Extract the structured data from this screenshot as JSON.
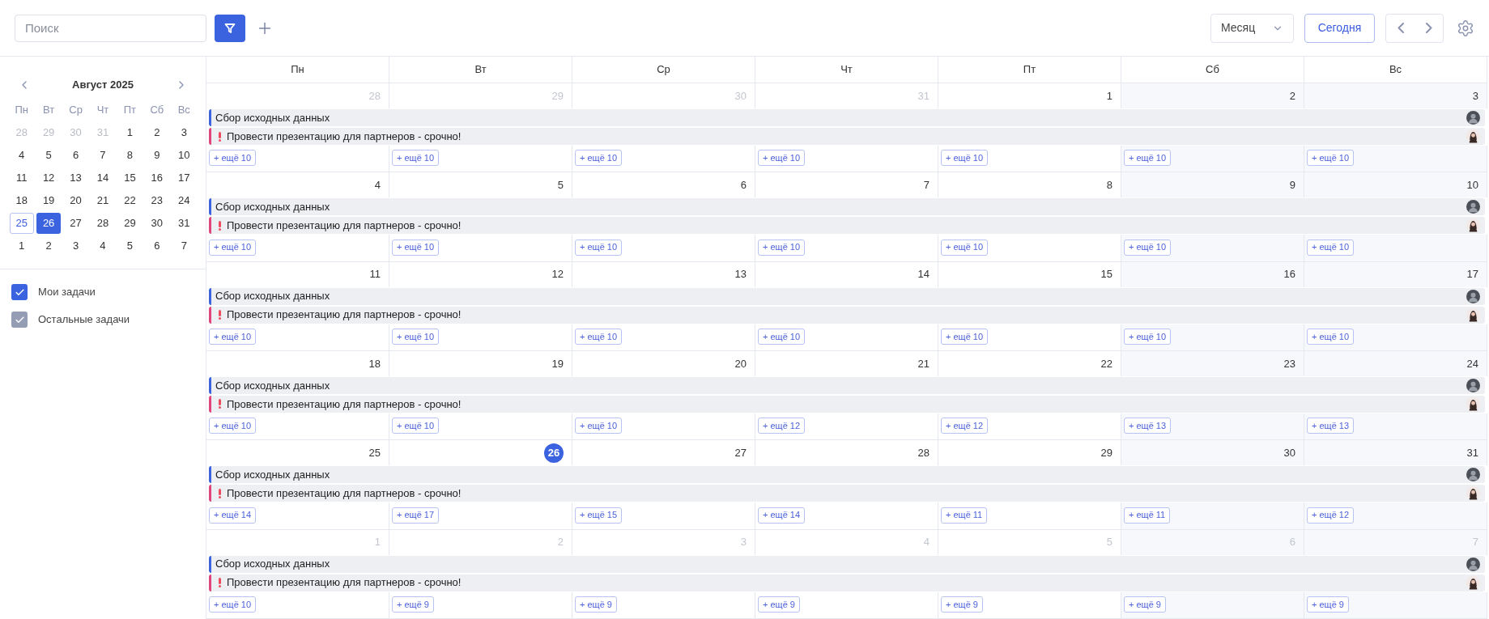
{
  "toolbar": {
    "search": {
      "placeholder": "Поиск"
    },
    "view_select": {
      "value": "Месяц"
    },
    "today_button": "Сегодня"
  },
  "mini_calendar": {
    "title": "Август 2025",
    "weekdays": [
      "Пн",
      "Вт",
      "Ср",
      "Чт",
      "Пт",
      "Сб",
      "Вс"
    ],
    "weeks": [
      [
        {
          "date": "28",
          "muted": true,
          "selected": false,
          "outlined": false
        },
        {
          "date": "29",
          "muted": true,
          "selected": false,
          "outlined": false
        },
        {
          "date": "30",
          "muted": true,
          "selected": false,
          "outlined": false
        },
        {
          "date": "31",
          "muted": true,
          "selected": false,
          "outlined": false
        },
        {
          "date": "1",
          "muted": false,
          "selected": false,
          "outlined": false
        },
        {
          "date": "2",
          "muted": false,
          "selected": false,
          "outlined": false
        },
        {
          "date": "3",
          "muted": false,
          "selected": false,
          "outlined": false
        }
      ],
      [
        {
          "date": "4",
          "muted": false,
          "selected": false,
          "outlined": false
        },
        {
          "date": "5",
          "muted": false,
          "selected": false,
          "outlined": false
        },
        {
          "date": "6",
          "muted": false,
          "selected": false,
          "outlined": false
        },
        {
          "date": "7",
          "muted": false,
          "selected": false,
          "outlined": false
        },
        {
          "date": "8",
          "muted": false,
          "selected": false,
          "outlined": false
        },
        {
          "date": "9",
          "muted": false,
          "selected": false,
          "outlined": false
        },
        {
          "date": "10",
          "muted": false,
          "selected": false,
          "outlined": false
        }
      ],
      [
        {
          "date": "11",
          "muted": false,
          "selected": false,
          "outlined": false
        },
        {
          "date": "12",
          "muted": false,
          "selected": false,
          "outlined": false
        },
        {
          "date": "13",
          "muted": false,
          "selected": false,
          "outlined": false
        },
        {
          "date": "14",
          "muted": false,
          "selected": false,
          "outlined": false
        },
        {
          "date": "15",
          "muted": false,
          "selected": false,
          "outlined": false
        },
        {
          "date": "16",
          "muted": false,
          "selected": false,
          "outlined": false
        },
        {
          "date": "17",
          "muted": false,
          "selected": false,
          "outlined": false
        }
      ],
      [
        {
          "date": "18",
          "muted": false,
          "selected": false,
          "outlined": false
        },
        {
          "date": "19",
          "muted": false,
          "selected": false,
          "outlined": false
        },
        {
          "date": "20",
          "muted": false,
          "selected": false,
          "outlined": false
        },
        {
          "date": "21",
          "muted": false,
          "selected": false,
          "outlined": false
        },
        {
          "date": "22",
          "muted": false,
          "selected": false,
          "outlined": false
        },
        {
          "date": "23",
          "muted": false,
          "selected": false,
          "outlined": false
        },
        {
          "date": "24",
          "muted": false,
          "selected": false,
          "outlined": false
        }
      ],
      [
        {
          "date": "25",
          "muted": false,
          "selected": false,
          "outlined": true
        },
        {
          "date": "26",
          "muted": false,
          "selected": true,
          "outlined": false
        },
        {
          "date": "27",
          "muted": false,
          "selected": false,
          "outlined": false
        },
        {
          "date": "28",
          "muted": false,
          "selected": false,
          "outlined": false
        },
        {
          "date": "29",
          "muted": false,
          "selected": false,
          "outlined": false
        },
        {
          "date": "30",
          "muted": false,
          "selected": false,
          "outlined": false
        },
        {
          "date": "31",
          "muted": false,
          "selected": false,
          "outlined": false
        }
      ],
      [
        {
          "date": "1",
          "muted": false,
          "selected": false,
          "outlined": false
        },
        {
          "date": "2",
          "muted": false,
          "selected": false,
          "outlined": false
        },
        {
          "date": "3",
          "muted": false,
          "selected": false,
          "outlined": false
        },
        {
          "date": "4",
          "muted": false,
          "selected": false,
          "outlined": false
        },
        {
          "date": "5",
          "muted": false,
          "selected": false,
          "outlined": false
        },
        {
          "date": "6",
          "muted": false,
          "selected": false,
          "outlined": false
        },
        {
          "date": "7",
          "muted": false,
          "selected": false,
          "outlined": false
        }
      ]
    ]
  },
  "filters": [
    {
      "label": "Мои задачи",
      "checked": true,
      "color": "#3b63e0"
    },
    {
      "label": "Остальные задачи",
      "checked": true,
      "color": "#959db5"
    }
  ],
  "calendar": {
    "weekdays": [
      "Пн",
      "Вт",
      "Ср",
      "Чт",
      "Пт",
      "Сб",
      "Вс"
    ],
    "weeks": [
      {
        "days": [
          {
            "date": "28",
            "muted": true,
            "today": false,
            "more": "+ ещё 10"
          },
          {
            "date": "29",
            "muted": true,
            "today": false,
            "more": "+ ещё 10"
          },
          {
            "date": "30",
            "muted": true,
            "today": false,
            "more": "+ ещё 10"
          },
          {
            "date": "31",
            "muted": true,
            "today": false,
            "more": "+ ещё 10"
          },
          {
            "date": "1",
            "muted": false,
            "today": false,
            "more": "+ ещё 10"
          },
          {
            "date": "2",
            "muted": false,
            "today": false,
            "more": "+ ещё 10"
          },
          {
            "date": "3",
            "muted": false,
            "today": false,
            "more": "+ ещё 10"
          }
        ],
        "events": [
          {
            "title": "Сбор исходных данных",
            "kind": "normal",
            "color": "#3d63dd"
          },
          {
            "title": "Провести презентацию для партнеров - срочно!",
            "kind": "urgent",
            "color": "#e0457b"
          }
        ]
      },
      {
        "days": [
          {
            "date": "4",
            "muted": false,
            "today": false,
            "more": "+ ещё 10"
          },
          {
            "date": "5",
            "muted": false,
            "today": false,
            "more": "+ ещё 10"
          },
          {
            "date": "6",
            "muted": false,
            "today": false,
            "more": "+ ещё 10"
          },
          {
            "date": "7",
            "muted": false,
            "today": false,
            "more": "+ ещё 10"
          },
          {
            "date": "8",
            "muted": false,
            "today": false,
            "more": "+ ещё 10"
          },
          {
            "date": "9",
            "muted": false,
            "today": false,
            "more": "+ ещё 10"
          },
          {
            "date": "10",
            "muted": false,
            "today": false,
            "more": "+ ещё 10"
          }
        ],
        "events": [
          {
            "title": "Сбор исходных данных",
            "kind": "normal",
            "color": "#3d63dd"
          },
          {
            "title": "Провести презентацию для партнеров - срочно!",
            "kind": "urgent",
            "color": "#e0457b"
          }
        ]
      },
      {
        "days": [
          {
            "date": "11",
            "muted": false,
            "today": false,
            "more": "+ ещё 10"
          },
          {
            "date": "12",
            "muted": false,
            "today": false,
            "more": "+ ещё 10"
          },
          {
            "date": "13",
            "muted": false,
            "today": false,
            "more": "+ ещё 10"
          },
          {
            "date": "14",
            "muted": false,
            "today": false,
            "more": "+ ещё 10"
          },
          {
            "date": "15",
            "muted": false,
            "today": false,
            "more": "+ ещё 10"
          },
          {
            "date": "16",
            "muted": false,
            "today": false,
            "more": "+ ещё 10"
          },
          {
            "date": "17",
            "muted": false,
            "today": false,
            "more": "+ ещё 10"
          }
        ],
        "events": [
          {
            "title": "Сбор исходных данных",
            "kind": "normal",
            "color": "#3d63dd"
          },
          {
            "title": "Провести презентацию для партнеров - срочно!",
            "kind": "urgent",
            "color": "#e0457b"
          }
        ]
      },
      {
        "days": [
          {
            "date": "18",
            "muted": false,
            "today": false,
            "more": "+ ещё 10"
          },
          {
            "date": "19",
            "muted": false,
            "today": false,
            "more": "+ ещё 10"
          },
          {
            "date": "20",
            "muted": false,
            "today": false,
            "more": "+ ещё 10"
          },
          {
            "date": "21",
            "muted": false,
            "today": false,
            "more": "+ ещё 12"
          },
          {
            "date": "22",
            "muted": false,
            "today": false,
            "more": "+ ещё 12"
          },
          {
            "date": "23",
            "muted": false,
            "today": false,
            "more": "+ ещё 13"
          },
          {
            "date": "24",
            "muted": false,
            "today": false,
            "more": "+ ещё 13"
          }
        ],
        "events": [
          {
            "title": "Сбор исходных данных",
            "kind": "normal",
            "color": "#3d63dd"
          },
          {
            "title": "Провести презентацию для партнеров - срочно!",
            "kind": "urgent",
            "color": "#e0457b"
          }
        ]
      },
      {
        "days": [
          {
            "date": "25",
            "muted": false,
            "today": false,
            "more": "+ ещё 14"
          },
          {
            "date": "26",
            "muted": false,
            "today": true,
            "more": "+ ещё 17"
          },
          {
            "date": "27",
            "muted": false,
            "today": false,
            "more": "+ ещё 15"
          },
          {
            "date": "28",
            "muted": false,
            "today": false,
            "more": "+ ещё 14"
          },
          {
            "date": "29",
            "muted": false,
            "today": false,
            "more": "+ ещё 11"
          },
          {
            "date": "30",
            "muted": false,
            "today": false,
            "more": "+ ещё 11"
          },
          {
            "date": "31",
            "muted": false,
            "today": false,
            "more": "+ ещё 12"
          }
        ],
        "events": [
          {
            "title": "Сбор исходных данных",
            "kind": "normal",
            "color": "#3d63dd"
          },
          {
            "title": "Провести презентацию для партнеров - срочно!",
            "kind": "urgent",
            "color": "#e0457b"
          }
        ]
      },
      {
        "days": [
          {
            "date": "1",
            "muted": true,
            "today": false,
            "more": "+ ещё 10"
          },
          {
            "date": "2",
            "muted": true,
            "today": false,
            "more": "+ ещё 9"
          },
          {
            "date": "3",
            "muted": true,
            "today": false,
            "more": "+ ещё 9"
          },
          {
            "date": "4",
            "muted": true,
            "today": false,
            "more": "+ ещё 9"
          },
          {
            "date": "5",
            "muted": true,
            "today": false,
            "more": "+ ещё 9"
          },
          {
            "date": "6",
            "muted": true,
            "today": false,
            "more": "+ ещё 9"
          },
          {
            "date": "7",
            "muted": true,
            "today": false,
            "more": "+ ещё 9"
          }
        ],
        "events": [
          {
            "title": "Сбор исходных данных",
            "kind": "normal",
            "color": "#3d63dd"
          },
          {
            "title": "Провести презентацию для партнеров - срочно!",
            "kind": "urgent",
            "color": "#e0457b"
          }
        ]
      }
    ]
  }
}
